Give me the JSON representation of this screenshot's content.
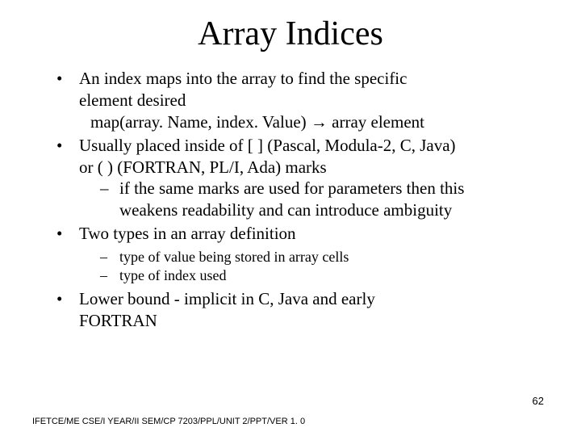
{
  "title": "Array Indices",
  "bullets": {
    "b1_line1": "An index maps into the array to find the specific",
    "b1_line2": "element desired",
    "b1_line3": " map(array. Name, index. Value) →  array element",
    "b2_line1": "Usually placed inside of [ ] (Pascal, Modula-2, C, Java)",
    "b2_line2": "or ( ) (FORTRAN, PL/I, Ada) marks",
    "b2_sub1_line1": "if the same marks are used for parameters then this",
    "b2_sub1_line2": "weakens readability and can introduce ambiguity",
    "b3_line1": "Two types in an array definition",
    "b3_sub1": "type of value being stored in array cells",
    "b3_sub2": "type of index used",
    "b4_line1": "Lower bound - implicit in C, Java and early",
    "b4_line2": "FORTRAN"
  },
  "footer": "IFETCE/ME CSE/I YEAR/II SEM/CP 7203/PPL/UNIT 2/PPT/VER 1. 0",
  "page_number": "62"
}
